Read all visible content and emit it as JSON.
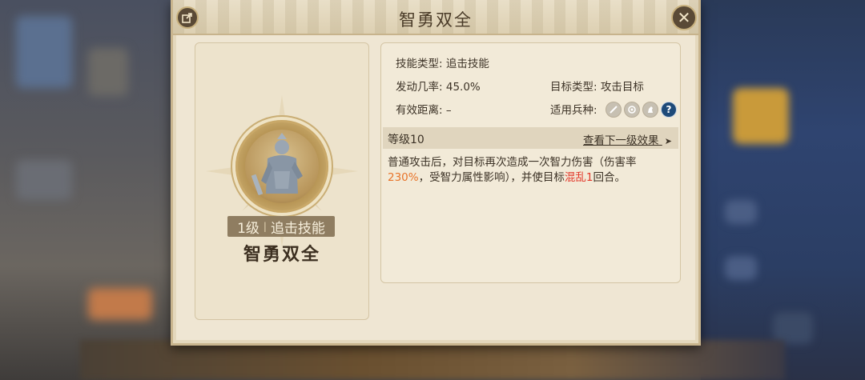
{
  "dialog": {
    "title": "智勇双全",
    "share_icon": "share-icon",
    "close_icon": "close-icon",
    "close_label": "✕"
  },
  "skill": {
    "level_tag": "1级",
    "type_tag": "追击技能",
    "name": "智勇双全"
  },
  "info": {
    "skill_type_label": "技能类型:",
    "skill_type_value": "追击技能",
    "trigger_rate_label": "发动几率:",
    "trigger_rate_value": "45.0%",
    "target_type_label": "目标类型:",
    "target_type_value": "攻击目标",
    "range_label": "有效距离:",
    "range_value": "–",
    "troop_label": "适用兵种:",
    "troop_icons": [
      "sword-icon",
      "bow-icon",
      "horse-icon",
      "question-icon"
    ]
  },
  "level": {
    "label": "等级10",
    "next_effect_link": "查看下一级效果",
    "next_arrow": "➤"
  },
  "description": {
    "part1": "普通攻击后，对目标再次造成一次智力伤害（伤害率",
    "rate": "230%",
    "part2": "，受智力属性影响），并使目标",
    "status": "混乱1",
    "part3": "回合。"
  },
  "colors": {
    "highlight_orange": "#e8742a",
    "highlight_red": "#e2392b",
    "dialog_bg": "#efe6d3"
  }
}
